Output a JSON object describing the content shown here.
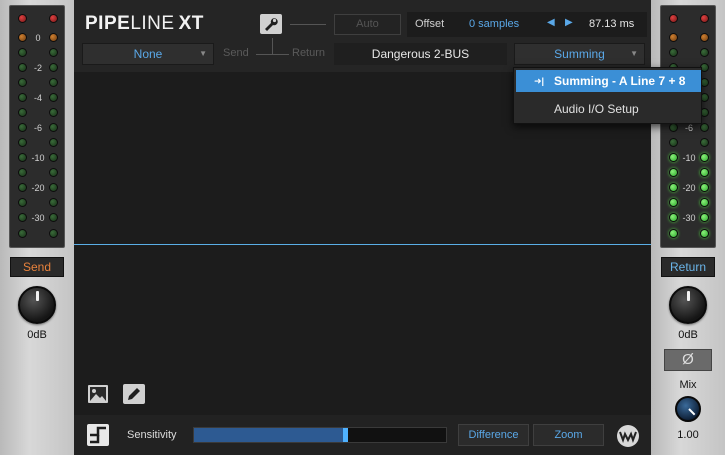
{
  "app": {
    "title_part1": "PIPE",
    "title_part2": "LINE",
    "title_part3": "XT"
  },
  "header": {
    "auto_label": "Auto",
    "offset_label": "Offset",
    "offset_value": "0 samples",
    "ms_value": "87.13 ms",
    "send_dropdown": "None",
    "send_label": "Send",
    "return_label": "Return",
    "insert_name": "Dangerous 2-BUS",
    "return_dropdown": "Summing"
  },
  "dropdown_menu": {
    "items": [
      {
        "label": "Summing - A Line 7 + 8",
        "icon": "input-arrow-icon",
        "selected": true
      },
      {
        "label": "Audio I/O Setup",
        "selected": false
      }
    ]
  },
  "left_panel": {
    "meter_labels": [
      "0",
      "-2",
      "-4",
      "-6",
      "-10",
      "-20",
      "-30"
    ],
    "tag_label": "Send",
    "knob_value": "0dB"
  },
  "right_panel": {
    "meter_labels": [
      "-6",
      "-10",
      "-20",
      "-30"
    ],
    "tag_label": "Return",
    "knob_value": "0dB",
    "phase_symbol": "Ø",
    "mix_label": "Mix",
    "mix_value": "1.00"
  },
  "bottom": {
    "sensitivity_label": "Sensitivity",
    "sensitivity_value": 0.6,
    "difference_label": "Difference",
    "zoom_label": "Zoom"
  },
  "colors": {
    "accent": "#5aa8e8",
    "send": "#e8823c",
    "return": "#6ab4e8",
    "highlight": "#3b8fd6"
  }
}
